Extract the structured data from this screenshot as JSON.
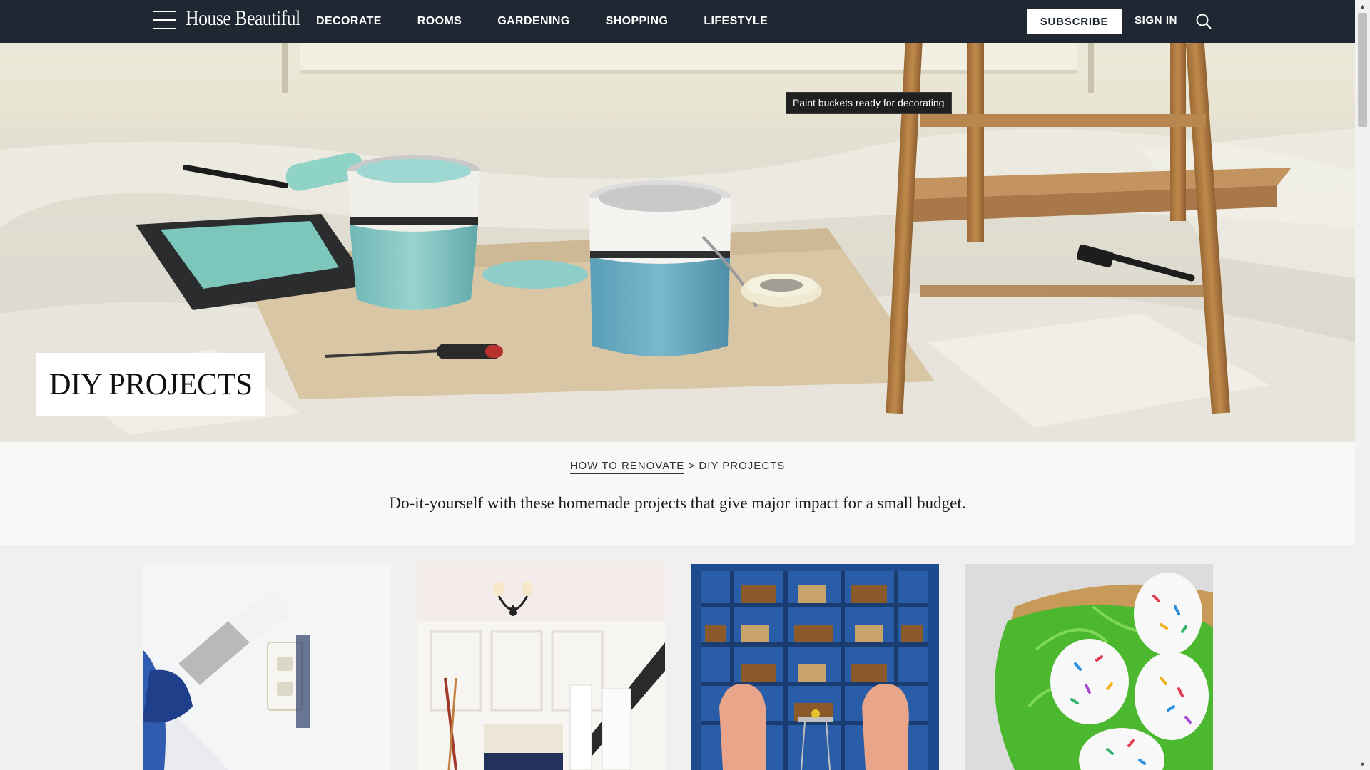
{
  "header": {
    "logo": "House Beautiful",
    "nav": [
      {
        "label": "DECORATE"
      },
      {
        "label": "ROOMS"
      },
      {
        "label": "GARDENING"
      },
      {
        "label": "SHOPPING"
      },
      {
        "label": "LIFESTYLE"
      }
    ],
    "subscribe_label": "SUBSCRIBE",
    "signin_label": "SIGN IN",
    "icons": {
      "menu": "hamburger-menu-icon",
      "search": "search-icon"
    }
  },
  "hero": {
    "tooltip": "Paint buckets ready for decorating",
    "title": "DIY PROJECTS",
    "image_alt": "Paint buckets ready for decorating"
  },
  "intro": {
    "breadcrumb": {
      "parent": "HOW TO RENOVATE",
      "separator": ">",
      "current": "DIY PROJECTS"
    },
    "description": "Do-it-yourself with these homemade projects that give major impact for a small budget."
  },
  "cards": [
    {
      "image": "painting-outlet"
    },
    {
      "image": "white-wainscot-hallway"
    },
    {
      "image": "blue-bookshelves-library"
    },
    {
      "image": "sprinkle-easter-eggs"
    }
  ],
  "colors": {
    "header_bg": "#1f2733",
    "page_bg": "#f2f0ee",
    "intro_bg": "#f9f8f7",
    "text": "#1a1a1a"
  }
}
